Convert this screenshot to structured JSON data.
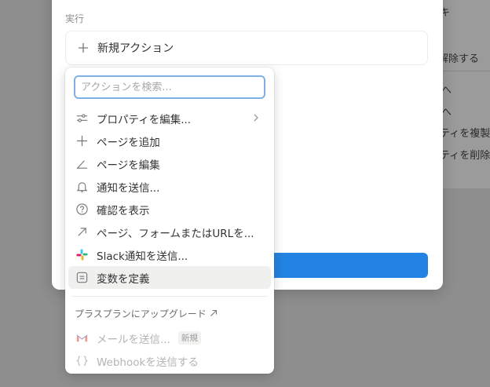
{
  "background": {
    "items": [
      "キ",
      "解除する",
      "へ",
      "へ",
      "ティを複製",
      "ティを削除"
    ]
  },
  "modal": {
    "section_label": "実行",
    "add_action_label": "新規アクション"
  },
  "dropdown": {
    "search_placeholder": "アクションを検索...",
    "items": [
      {
        "label": "プロパティを編集...",
        "icon": "sliders-icon",
        "submenu": true
      },
      {
        "label": "ページを追加",
        "icon": "plus-icon"
      },
      {
        "label": "ページを編集",
        "icon": "edit-page-icon"
      },
      {
        "label": "通知を送信...",
        "icon": "bell-icon"
      },
      {
        "label": "確認を表示",
        "icon": "question-circle-icon"
      },
      {
        "label": "ページ、フォームまたはURLを...",
        "icon": "arrow-up-right-icon"
      },
      {
        "label": "Slack通知を送信...",
        "icon": "slack-icon"
      },
      {
        "label": "変数を定義",
        "icon": "variable-icon",
        "highlighted": true
      }
    ],
    "upgrade_label": "プラスプランにアップグレード",
    "locked_items": [
      {
        "label": "メールを送信...",
        "icon": "gmail-icon",
        "badge": "新規"
      },
      {
        "label": "Webhookを送信する",
        "icon": "braces-icon"
      }
    ]
  },
  "colors": {
    "accent": "#2383e2",
    "focus_ring": "#7fb1e6",
    "overlay": "#8e8e8e"
  }
}
